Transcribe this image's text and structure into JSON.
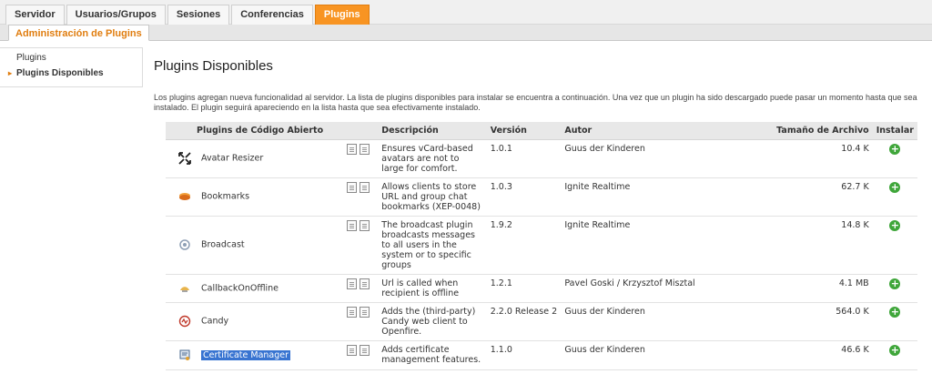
{
  "topnav": {
    "tabs": [
      {
        "label": "Servidor",
        "active": false
      },
      {
        "label": "Usuarios/Grupos",
        "active": false
      },
      {
        "label": "Sesiones",
        "active": false
      },
      {
        "label": "Conferencias",
        "active": false
      },
      {
        "label": "Plugins",
        "active": true
      }
    ]
  },
  "subnav": {
    "active_tab": "Administración de Plugins"
  },
  "sidebar": {
    "items": [
      {
        "label": "Plugins",
        "selected": false
      },
      {
        "label": "Plugins Disponibles",
        "selected": true
      }
    ]
  },
  "page": {
    "title": "Plugins Disponibles",
    "description": "Los plugins agregan nueva funcionalidad al servidor. La lista de plugins disponibles para instalar se encuentra a continuación. Una vez que un plugin ha sido descargado puede pasar un momento hasta que sea instalado. El plugin seguirá apareciendo en la lista hasta que sea efectivamente instalado."
  },
  "table": {
    "headers": {
      "name": "Plugins de Código Abierto",
      "description": "Descripción",
      "version": "Versión",
      "author": "Autor",
      "size": "Tamaño de Archivo",
      "install": "Instalar"
    },
    "rows": [
      {
        "icon": "avatar-resizer-icon",
        "name": "Avatar Resizer",
        "description": "Ensures vCard-based avatars are not to large for comfort.",
        "version": "1.0.1",
        "author": "Guus der Kinderen",
        "size": "10.4 K"
      },
      {
        "icon": "bookmarks-icon",
        "name": "Bookmarks",
        "description": "Allows clients to store URL and group chat bookmarks (XEP-0048)",
        "version": "1.0.3",
        "author": "Ignite Realtime",
        "size": "62.7 K"
      },
      {
        "icon": "broadcast-icon",
        "name": "Broadcast",
        "description": "The broadcast plugin broadcasts messages to all users in the system or to specific groups",
        "version": "1.9.2",
        "author": "Ignite Realtime",
        "size": "14.8 K"
      },
      {
        "icon": "callback-offline-icon",
        "name": "CallbackOnOffline",
        "description": "Url is called when recipient is offline",
        "version": "1.2.1",
        "author": "Pavel Goski / Krzysztof Misztal",
        "size": "4.1 MB"
      },
      {
        "icon": "candy-icon",
        "name": "Candy",
        "description": "Adds the (third-party) Candy web client to Openfire.",
        "version": "2.2.0 Release 2",
        "author": "Guus der Kinderen",
        "size": "564.0 K"
      },
      {
        "icon": "certificate-icon",
        "name": "Certificate Manager",
        "description": "Adds certificate management features.",
        "version": "1.1.0",
        "author": "Guus der Kinderen",
        "size": "46.6 K",
        "selected": true
      }
    ]
  }
}
